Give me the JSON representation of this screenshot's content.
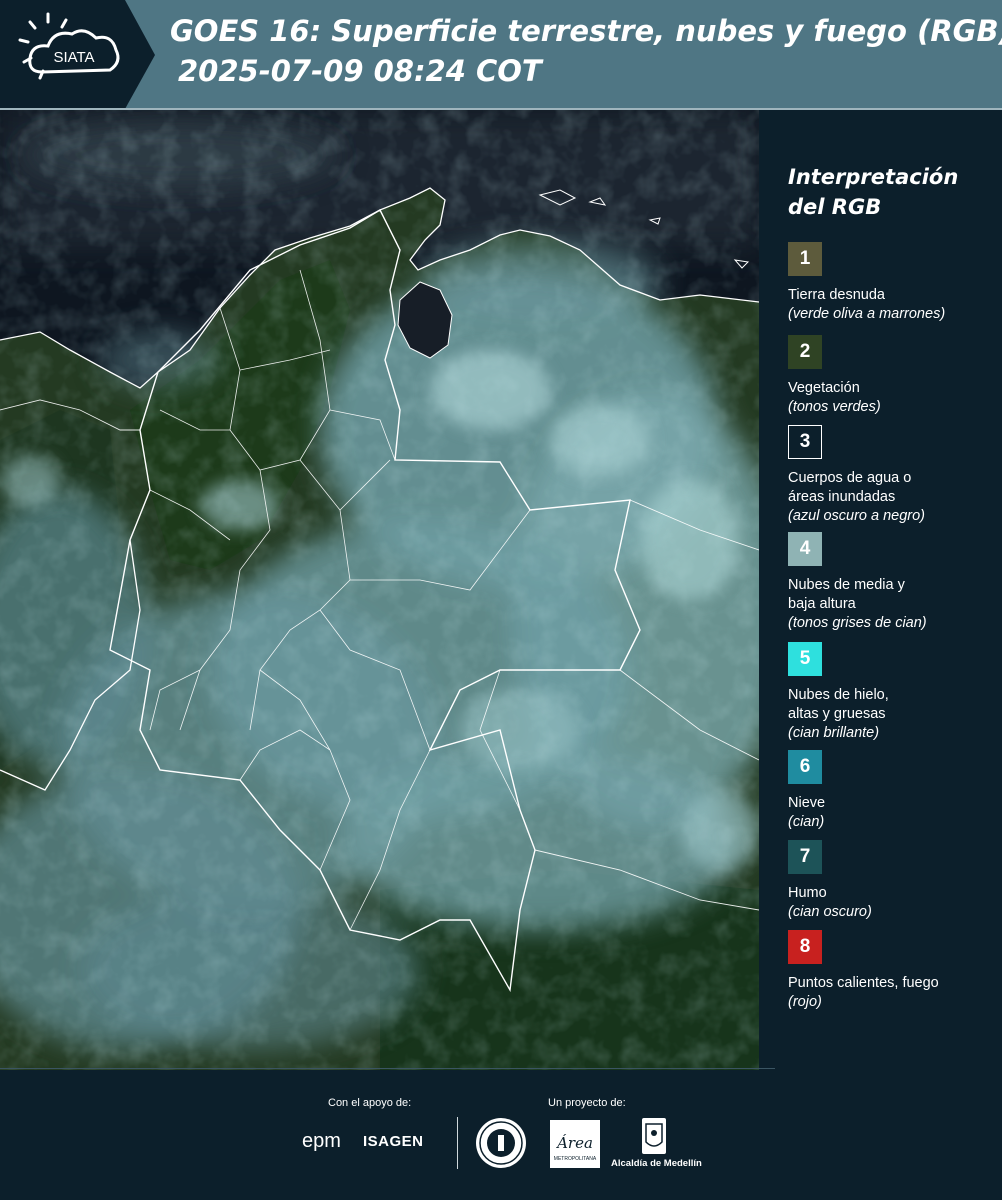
{
  "header": {
    "logo_text": "SIATA",
    "title_line1": "GOES 16: Superficie terrestre, nubes y fuego (RGB)",
    "title_line2": "2025-07-09 08:24 COT"
  },
  "legend": {
    "title_line1": "Interpretación",
    "title_line2": "del RGB",
    "items": [
      {
        "number": "1",
        "label": "Tierra desnuda",
        "desc": "(verde oliva a marrones)",
        "color": "#5d5b3c",
        "border": "#5d5b3c"
      },
      {
        "number": "2",
        "label": "Vegetación",
        "desc": "(tonos verdes)",
        "color": "#2f4324",
        "border": "#2f4324"
      },
      {
        "number": "3",
        "label": "Cuerpos de agua o\náreas inundadas",
        "desc": "(azul oscuro a negro)",
        "color": "#0c1f2b",
        "border": "#ffffff"
      },
      {
        "number": "4",
        "label": "Nubes de media y\nbaja altura",
        "desc": "(tonos grises de cian)",
        "color": "#8fb3b4",
        "border": "#8fb3b4"
      },
      {
        "number": "5",
        "label": "Nubes de hielo,\naltas y gruesas",
        "desc": "(cian brillante)",
        "color": "#2ee0de",
        "border": "#2ee0de"
      },
      {
        "number": "6",
        "label": "Nieve",
        "desc": "(cian)",
        "color": "#1f8ca0",
        "border": "#1f8ca0"
      },
      {
        "number": "7",
        "label": "Humo",
        "desc": "(cian oscuro)",
        "color": "#1d5358",
        "border": "#1d5358"
      },
      {
        "number": "8",
        "label": "Puntos calientes, fuego",
        "desc": "(rojo)",
        "color": "#c8211f",
        "border": "#c8211f"
      }
    ]
  },
  "footer": {
    "support_label": "Con el apoyo de:",
    "project_label": "Un proyecto de:",
    "brand_epm": "epm",
    "brand_isagen": "ISAGEN",
    "area_logo_text": "Área",
    "area_logo_sub": "METROPOLITANA",
    "alcaldia": "Alcaldía de Medellín"
  },
  "colors": {
    "background": "#0c1f2b",
    "header": "#4f7684",
    "ocean": "#0d1722",
    "vegetation": "#24381f",
    "cloud": "#6f9ea3",
    "borders": "#ffffff"
  }
}
